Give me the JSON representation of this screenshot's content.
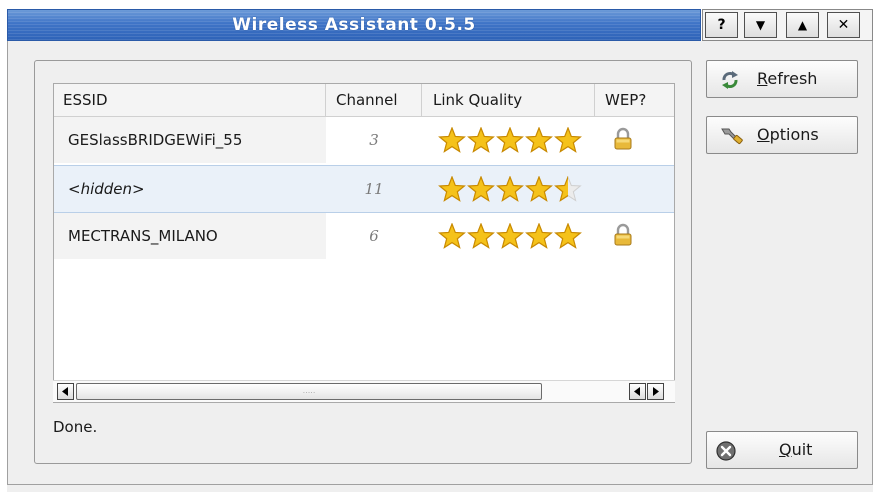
{
  "window": {
    "title": "Wireless Assistant 0.5.5",
    "controls": {
      "help": "?",
      "shade": "▼",
      "maximize": "▲",
      "close": "✕"
    }
  },
  "table": {
    "headers": {
      "essid": "ESSID",
      "channel": "Channel",
      "quality": "Link Quality",
      "wep": "WEP?"
    },
    "rows": [
      {
        "essid": "GESlassBRIDGEWiFi_55",
        "channel": "3",
        "stars": 5,
        "wep": true,
        "selected": false
      },
      {
        "essid": "<hidden>",
        "channel": "11",
        "stars": 4.5,
        "wep": false,
        "selected": true
      },
      {
        "essid": "MECTRANS_MILANO",
        "channel": "6",
        "stars": 5,
        "wep": true,
        "selected": false
      }
    ],
    "max_stars": 5
  },
  "scrollbar": {
    "grip": "....."
  },
  "status": "Done.",
  "buttons": {
    "refresh": {
      "mnemonic": "R",
      "rest": "efresh",
      "icon": "refresh-icon"
    },
    "options": {
      "mnemonic": "O",
      "rest": "ptions",
      "icon": "wrench-icon"
    },
    "quit": {
      "mnemonic": "Q",
      "rest": "uit",
      "icon": "quit-icon"
    }
  },
  "colors": {
    "titlebar": "#3f74c7",
    "star": "#f5c21a",
    "star_outline": "#c98a00",
    "selection": "#eaf1f9",
    "lock": "#e8b93a"
  }
}
